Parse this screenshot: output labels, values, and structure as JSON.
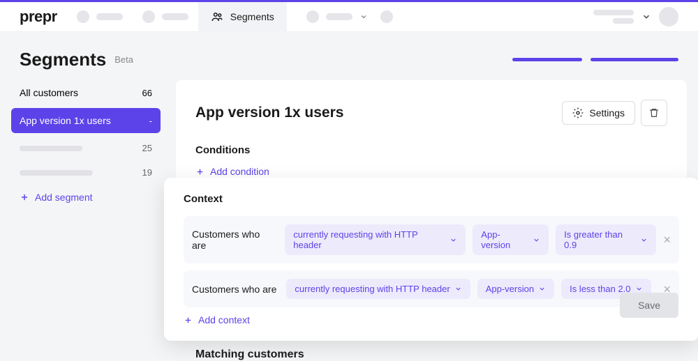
{
  "brand": "prepr",
  "nav": {
    "active": "Segments"
  },
  "page": {
    "title": "Segments",
    "badge": "Beta"
  },
  "sidebar": {
    "items": [
      {
        "label": "All customers",
        "count": "66"
      },
      {
        "label": "App version 1x users",
        "count": "-"
      }
    ],
    "placeholders": [
      {
        "width": 90,
        "count": "25"
      },
      {
        "width": 105,
        "count": "19"
      }
    ],
    "add_label": "Add segment"
  },
  "main": {
    "title": "App version 1x users",
    "settings_label": "Settings",
    "conditions_title": "Conditions",
    "add_condition_label": "Add condition",
    "context": {
      "title": "Context",
      "rows": [
        {
          "prefix": "Customers who are",
          "pills": [
            "currently requesting with HTTP header",
            "App-version",
            "Is greater than 0.9"
          ]
        },
        {
          "prefix": "Customers who are",
          "pills": [
            "currently requesting with HTTP header",
            "App-version",
            "Is less than 2.0"
          ]
        }
      ],
      "add_label": "Add context"
    },
    "save_label": "Save",
    "matching_title": "Matching customers"
  }
}
